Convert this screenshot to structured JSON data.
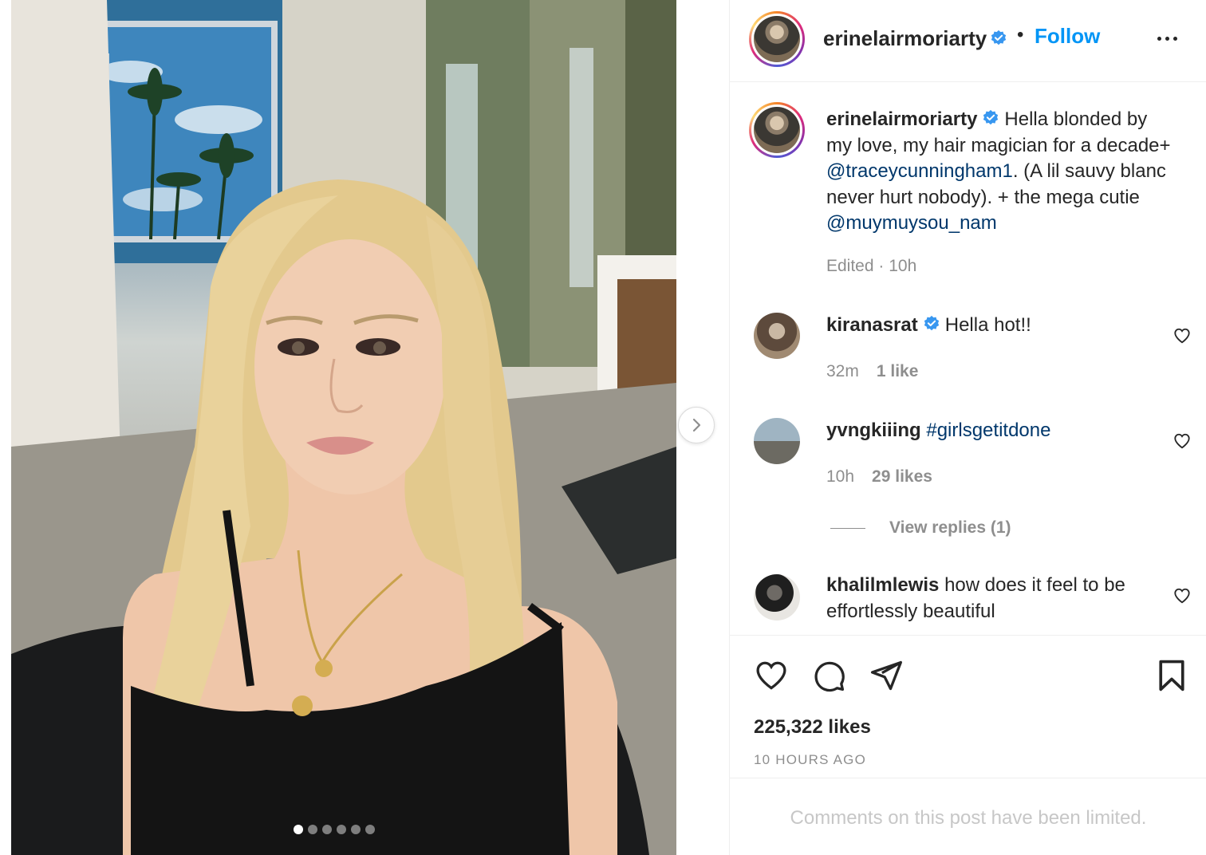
{
  "post": {
    "username": "erinelairmoriarty",
    "follow_label": "Follow",
    "separator": "•",
    "caption_text": "Hella blonded by my love, my hair magician for a decade+ ",
    "caption_mention_1": "@traceycunningham1",
    "caption_text_2": ". (A lil sauvy blanc never hurt nobody). + the mega cutie ",
    "caption_mention_2": "@muymuysou_nam",
    "caption_meta": "Edited · 10h",
    "likes": "225,322 likes",
    "time_ago": "10 HOURS AGO",
    "comments_limited": "Comments on this post have been limited.",
    "carousel": {
      "count": 6,
      "active_index": 0
    }
  },
  "comments": [
    {
      "username": "kiranasrat",
      "verified": true,
      "text": "Hella hot!!",
      "time": "32m",
      "likes": "1 like"
    },
    {
      "username": "yvngkiiing",
      "verified": false,
      "text": "#girlsgetitdone",
      "time": "10h",
      "likes": "29 likes",
      "replies": "View replies (1)"
    },
    {
      "username": "khalilmlewis",
      "verified": false,
      "text": "how does it feel to be effortlessly beautiful"
    }
  ],
  "colors": {
    "link_blue": "#0095f6",
    "mention_blue": "#00376b",
    "verified_blue": "#3897f0",
    "muted": "#8e8e8e"
  },
  "icons": [
    "verified-badge-icon",
    "more-options-icon",
    "heart-icon",
    "comment-icon",
    "share-icon",
    "bookmark-icon",
    "chevron-right-icon"
  ]
}
